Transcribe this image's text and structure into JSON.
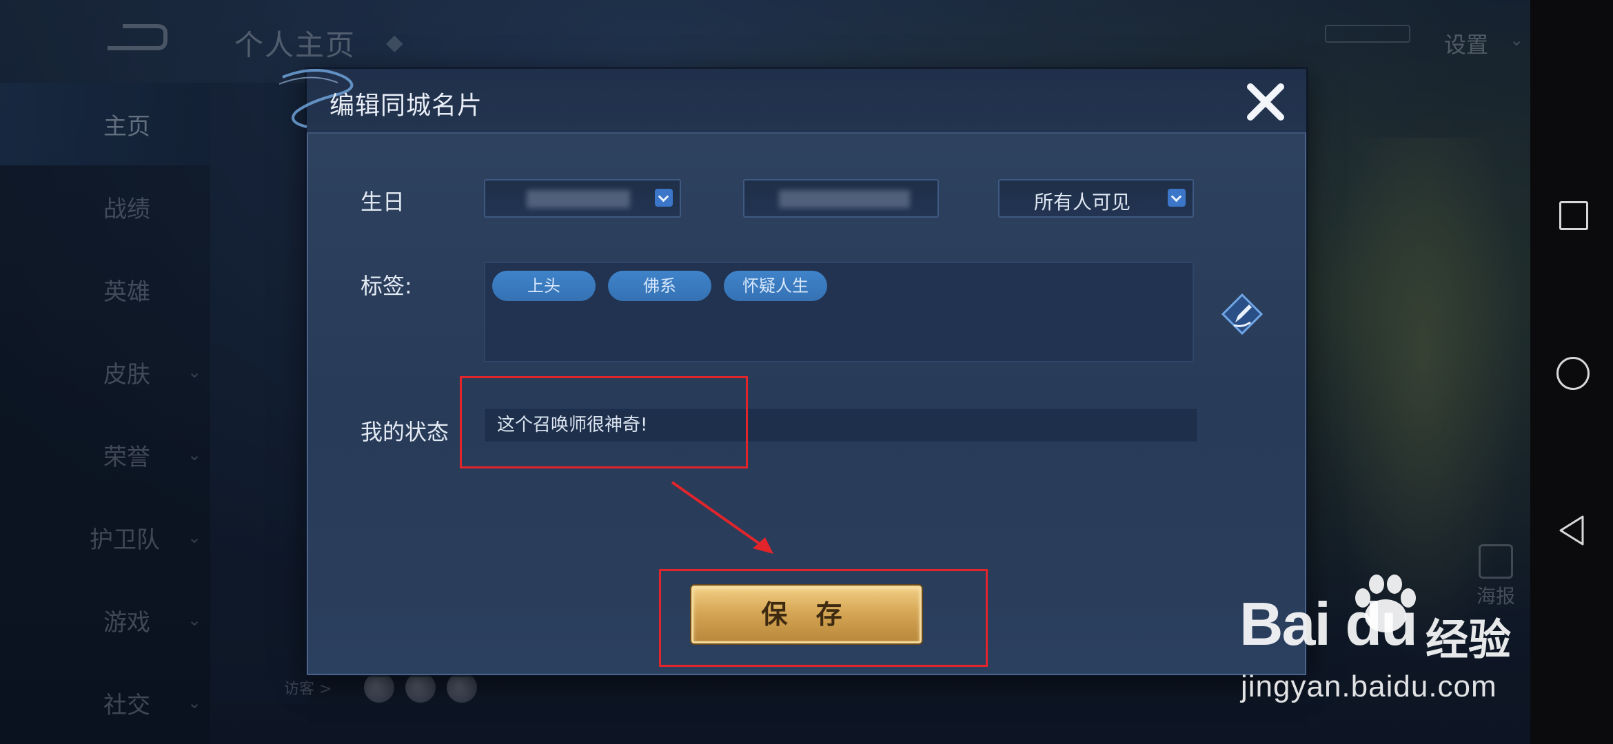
{
  "background": {
    "page_title": "个人主页",
    "settings_label": "设置",
    "sidebar": [
      {
        "label": "主页",
        "caret": false,
        "active": true
      },
      {
        "label": "战绩",
        "caret": false
      },
      {
        "label": "英雄",
        "caret": false
      },
      {
        "label": "皮肤",
        "caret": true
      },
      {
        "label": "荣誉",
        "caret": true
      },
      {
        "label": "护卫队",
        "caret": true
      },
      {
        "label": "游戏",
        "caret": true
      },
      {
        "label": "社交",
        "caret": true
      }
    ],
    "visitors_label": "访客 >",
    "poster_label": "海报"
  },
  "dialog": {
    "title": "编辑同城名片",
    "birthday_label": "生日",
    "visibility_value": "所有人可见",
    "tags_label": "标签:",
    "tags": [
      "上头",
      "佛系",
      "怀疑人生"
    ],
    "status_label": "我的状态",
    "status_value": "这个召唤师很神奇!",
    "save_label": "保 存"
  },
  "watermark": {
    "logo": "Bai du",
    "logo_cn": "经验",
    "url": "jingyan.baidu.com"
  },
  "colors": {
    "annotation_red": "#e1252b",
    "save_gold": "#d6a756",
    "tag_blue": "#3f83c9"
  }
}
